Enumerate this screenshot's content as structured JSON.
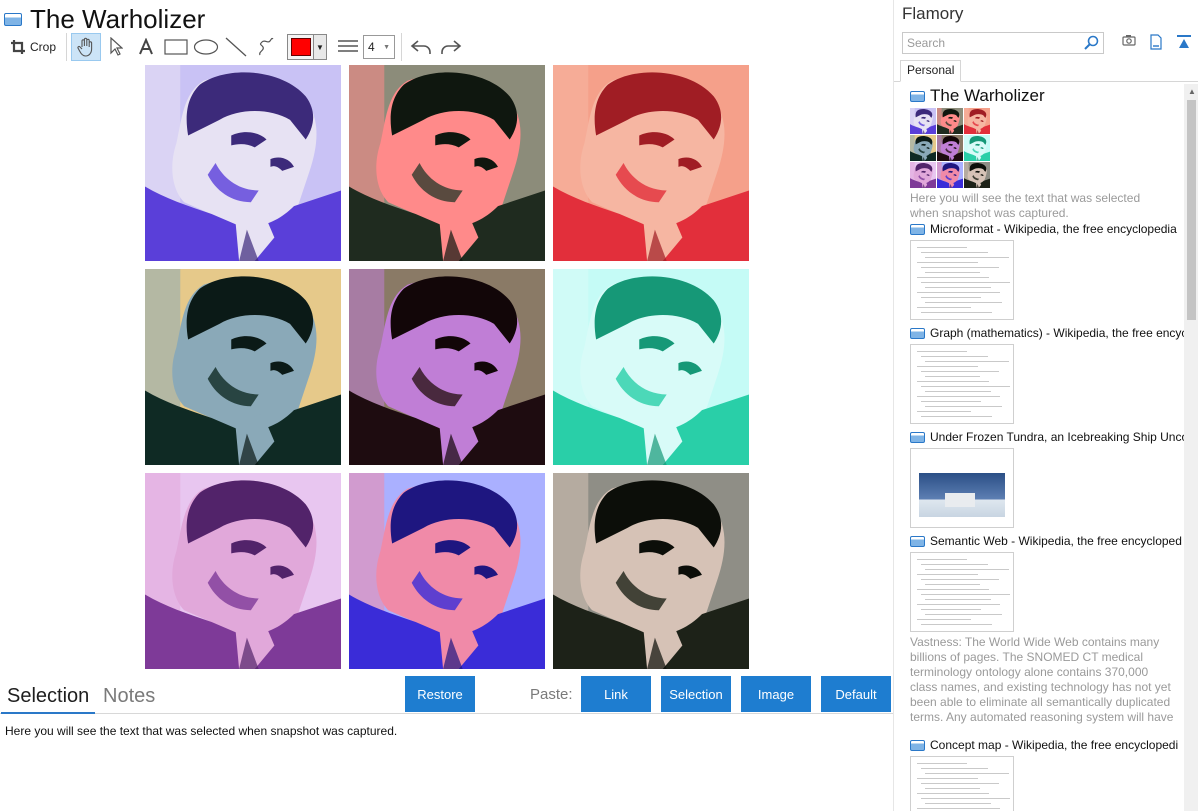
{
  "app": {
    "title": "The Warholizer"
  },
  "toolbar": {
    "crop_label": "Crop",
    "stroke_width": "4",
    "color": "#ff0000"
  },
  "grid": {
    "tiles": [
      {
        "bg": "#c9c2f5",
        "shade": "#5a3fd9",
        "shirt": "#5a3fd9",
        "skin": "#e7e2f3",
        "dark": "#3c2a7a"
      },
      {
        "bg": "#8c8c7a",
        "shade": "#2f3a2c",
        "shirt": "#1f2b1f",
        "skin": "#ff8a8a",
        "dark": "#0f170f"
      },
      {
        "bg": "#f5a08a",
        "shade": "#e22f3b",
        "shirt": "#e22f3b",
        "skin": "#f6b6a2",
        "dark": "#a01d24"
      },
      {
        "bg": "#e6c98a",
        "shade": "#0f2a24",
        "shirt": "#0f2a24",
        "skin": "#8aa9b8",
        "dark": "#0b1a17"
      },
      {
        "bg": "#8a7a66",
        "shade": "#2a1418",
        "shirt": "#1e0c10",
        "skin": "#c07ed6",
        "dark": "#120608"
      },
      {
        "bg": "#c5fbf6",
        "shade": "#29cfa8",
        "shirt": "#29cfa8",
        "skin": "#d8fbf8",
        "dark": "#169877"
      },
      {
        "bg": "#e8c6f0",
        "shade": "#7e3a98",
        "shirt": "#7e3a98",
        "skin": "#e1a8da",
        "dark": "#52236a"
      },
      {
        "bg": "#aab0ff",
        "shade": "#3a2cd8",
        "shirt": "#3a2cd8",
        "skin": "#f08aa8",
        "dark": "#1e1680"
      },
      {
        "bg": "#8f8e86",
        "shade": "#1d2218",
        "shirt": "#1d2218",
        "skin": "#d6c2b6",
        "dark": "#0c0e09"
      }
    ]
  },
  "bottom": {
    "tab_selection": "Selection",
    "tab_notes": "Notes",
    "restore_label": "Restore",
    "paste_label": "Paste:",
    "link_label": "Link",
    "selection_label": "Selection",
    "image_label": "Image",
    "default_label": "Default",
    "note_text": "Here you will see the text that was selected when snapshot was captured."
  },
  "sidebar": {
    "title": "Flamory",
    "search_placeholder": "Search",
    "tab_personal": "Personal",
    "items": [
      {
        "title": "The Warholizer",
        "text": "Here you will see the text that was selected when snapshot was captured."
      },
      {
        "title": "Microformat - Wikipedia, the free encyclopedia"
      },
      {
        "title": "Graph (mathematics) - Wikipedia, the free encyc"
      },
      {
        "title": "Under Frozen Tundra, an Icebreaking Ship Unco"
      },
      {
        "title": "Semantic Web - Wikipedia, the free encycloped",
        "text": "Vastness: The World Wide Web contains many billions of pages. The SNOMED CT medical terminology ontology alone contains 370,000 class names, and existing technology has not yet been able to eliminate all semantically duplicated terms. Any automated reasoning system will have to deal with truly huge inputs."
      },
      {
        "title": "Concept map - Wikipedia, the free encyclopedi"
      }
    ]
  }
}
